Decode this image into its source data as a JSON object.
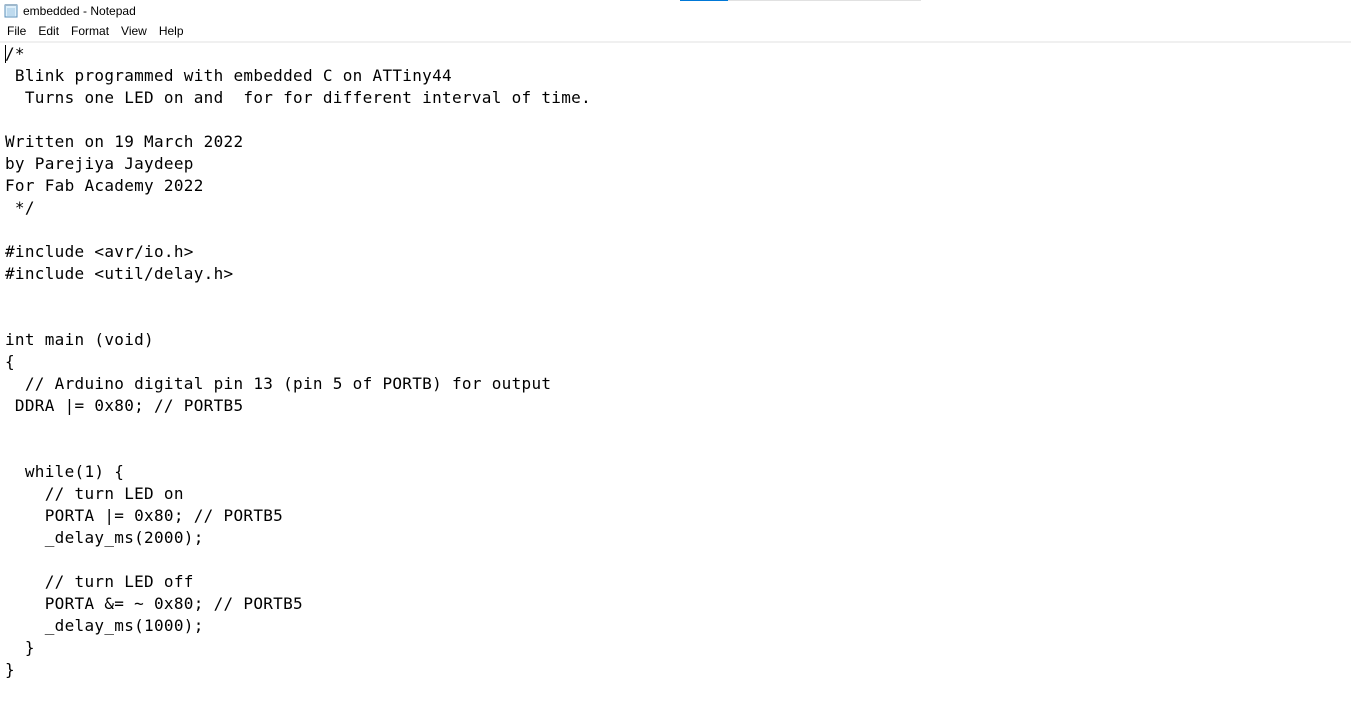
{
  "window": {
    "title": "embedded - Notepad",
    "icon": "notepad-icon"
  },
  "progress": {
    "fraction": 0.2
  },
  "menubar": {
    "items": [
      {
        "label": "File"
      },
      {
        "label": "Edit"
      },
      {
        "label": "Format"
      },
      {
        "label": "View"
      },
      {
        "label": "Help"
      }
    ]
  },
  "editor": {
    "content": "/*\n Blink programmed with embedded C on ATTiny44\n  Turns one LED on and  for for different interval of time.\n\nWritten on 19 March 2022\nby Parejiya Jaydeep\nFor Fab Academy 2022\n */\n\n#include <avr/io.h>\n#include <util/delay.h>\n\n\nint main (void)\n{\n  // Arduino digital pin 13 (pin 5 of PORTB) for output\n DDRA |= 0x80; // PORTB5\n\n\n  while(1) {\n    // turn LED on\n    PORTA |= 0x80; // PORTB5\n    _delay_ms(2000);\n\n    // turn LED off\n    PORTA &= ~ 0x80; // PORTB5\n    _delay_ms(1000);\n  }\n}"
  }
}
